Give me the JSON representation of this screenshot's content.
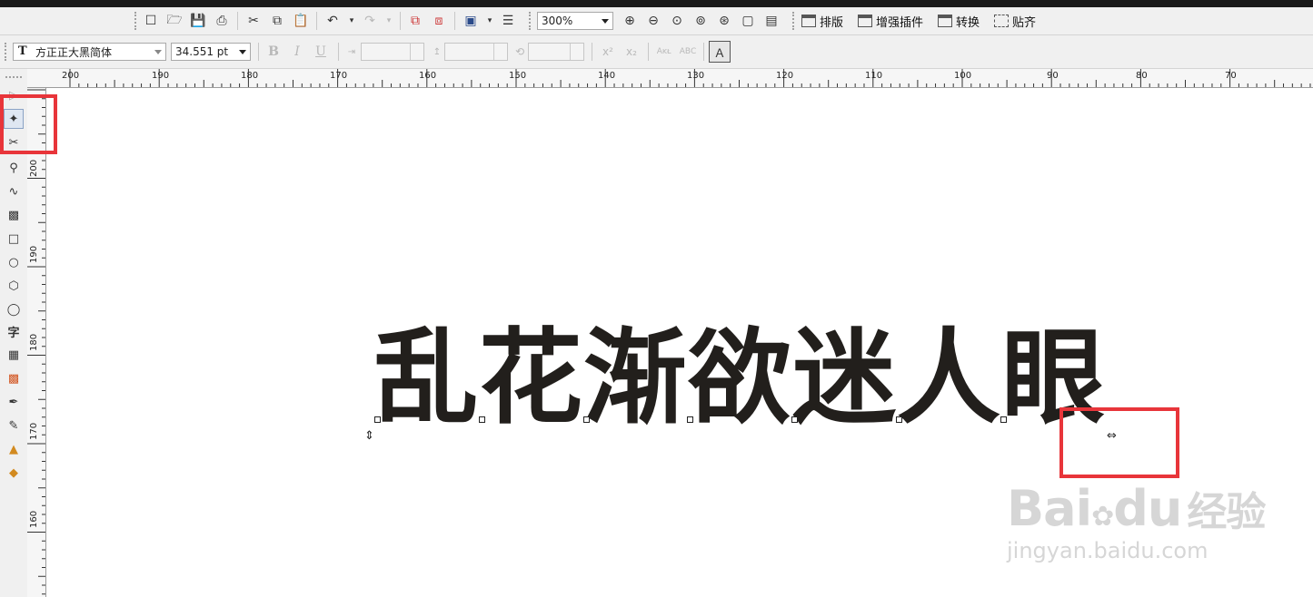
{
  "toolbar1": {
    "zoom_value": "300%",
    "menu_items": [
      "排版",
      "增强插件",
      "转换",
      "贴齐"
    ]
  },
  "toolbar2": {
    "font_name": "方正正大黑简体",
    "font_size": "34.551 pt"
  },
  "ruler_top_labels": [
    "200",
    "190",
    "180",
    "170",
    "160",
    "150",
    "140",
    "130",
    "120",
    "110",
    "100",
    "90",
    "80",
    "70"
  ],
  "ruler_left_labels": [
    "200",
    "190",
    "180",
    "170",
    "160"
  ],
  "toolbox": {
    "text_tool_label": "字"
  },
  "canvas": {
    "artistic_text": "乱花渐欲迷人眼"
  },
  "watermark": {
    "brand": "Bai",
    "brand_suffix": "du",
    "site_cn": "经验",
    "url": "jingyan.baidu.com"
  },
  "colors": {
    "highlight_red": "#e8353a",
    "text_fill": "#221f1c"
  }
}
